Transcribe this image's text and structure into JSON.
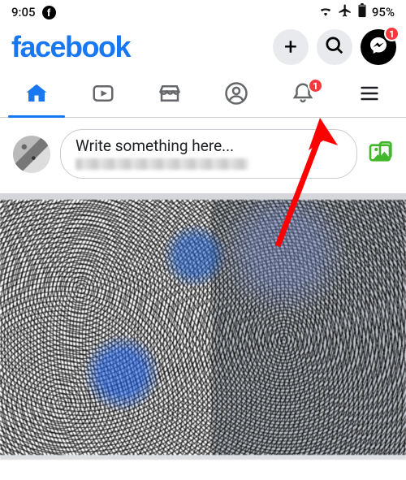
{
  "status": {
    "time": "9:05",
    "battery": "95%"
  },
  "logo": "facebook",
  "header_actions": {
    "messenger_badge": "1"
  },
  "tabs": {
    "notifications_badge": "1"
  },
  "composer": {
    "placeholder": "Write something here..."
  }
}
